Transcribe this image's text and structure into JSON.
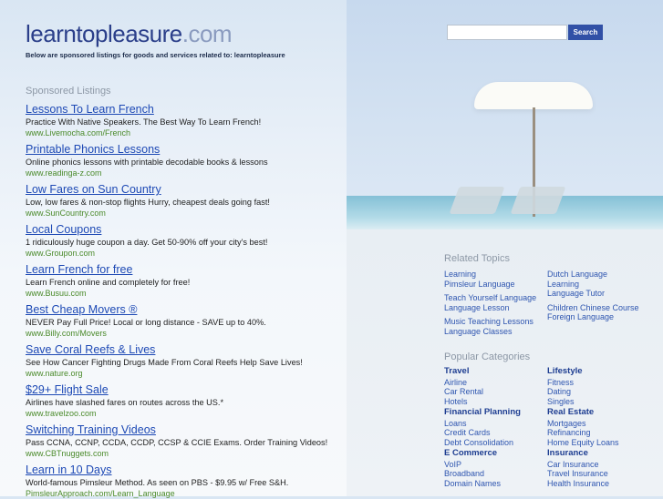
{
  "header": {
    "logo_main": "learntopleasure",
    "logo_tld": ".com",
    "subline": "Below are sponsored listings for goods and services related to: learntopleasure",
    "search_button": "Search",
    "search_placeholder": ""
  },
  "sponsored": {
    "heading": "Sponsored Listings",
    "items": [
      {
        "title": "Lessons To Learn French",
        "desc": "Practice With Native Speakers. The Best Way To Learn French!",
        "url": "www.Livemocha.com/French"
      },
      {
        "title": "Printable Phonics Lessons",
        "desc": "Online phonics lessons with printable decodable books & lessons",
        "url": "www.readinga-z.com"
      },
      {
        "title": "Low Fares on Sun Country",
        "desc": "Low, low fares & non-stop flights Hurry, cheapest deals going fast!",
        "url": "www.SunCountry.com"
      },
      {
        "title": "Local Coupons",
        "desc": "1 ridiculously huge coupon a day. Get 50-90% off your city's best!",
        "url": "www.Groupon.com"
      },
      {
        "title": "Learn French for free",
        "desc": "Learn French online and completely for free!",
        "url": "www.Busuu.com"
      },
      {
        "title": "Best Cheap Movers ®",
        "desc": "NEVER Pay Full Price! Local or long distance - SAVE up to 40%.",
        "url": "www.Billy.com/Movers"
      },
      {
        "title": "Save Coral Reefs & Lives",
        "desc": "See How Cancer Fighting Drugs Made From Coral Reefs Help Save Lives!",
        "url": "www.nature.org"
      },
      {
        "title": "$29+ Flight Sale",
        "desc": "Airlines have slashed fares on routes across the US.*",
        "url": "www.travelzoo.com"
      },
      {
        "title": "Switching Training Videos",
        "desc": "Pass CCNA, CCNP, CCDA, CCDP, CCSP & CCIE Exams. Order Training Videos!",
        "url": "www.CBTnuggets.com"
      },
      {
        "title": "Learn in 10 Days",
        "desc": "World-famous Pimsleur Method. As seen on PBS - $9.95 w/ Free S&H.",
        "url": "PimsleurApproach.com/Learn_Language"
      }
    ]
  },
  "related": {
    "heading": "Related Topics",
    "left": [
      "Learning",
      "Pimsleur Language",
      "Teach Yourself Language",
      "Language Lesson",
      "Music Teaching Lessons",
      "Language Classes"
    ],
    "right": [
      "Dutch Language",
      "Learning",
      "Language Tutor",
      "Children Chinese Course",
      "Foreign Language"
    ]
  },
  "popular": {
    "heading": "Popular Categories",
    "categories": [
      {
        "title": "Travel",
        "links": [
          "Airline",
          "Car Rental",
          "Hotels"
        ]
      },
      {
        "title": "Lifestyle",
        "links": [
          "Fitness",
          "Dating",
          "Singles"
        ]
      },
      {
        "title": "Financial Planning",
        "links": [
          "Loans",
          "Credit Cards",
          "Debt Consolidation"
        ]
      },
      {
        "title": "Real Estate",
        "links": [
          "Mortgages",
          "Refinancing",
          "Home Equity Loans"
        ]
      },
      {
        "title": "E Commerce",
        "links": [
          "VoIP",
          "Broadband",
          "Domain Names"
        ]
      },
      {
        "title": "Insurance",
        "links": [
          "Car Insurance",
          "Travel Insurance",
          "Health Insurance"
        ]
      }
    ]
  }
}
